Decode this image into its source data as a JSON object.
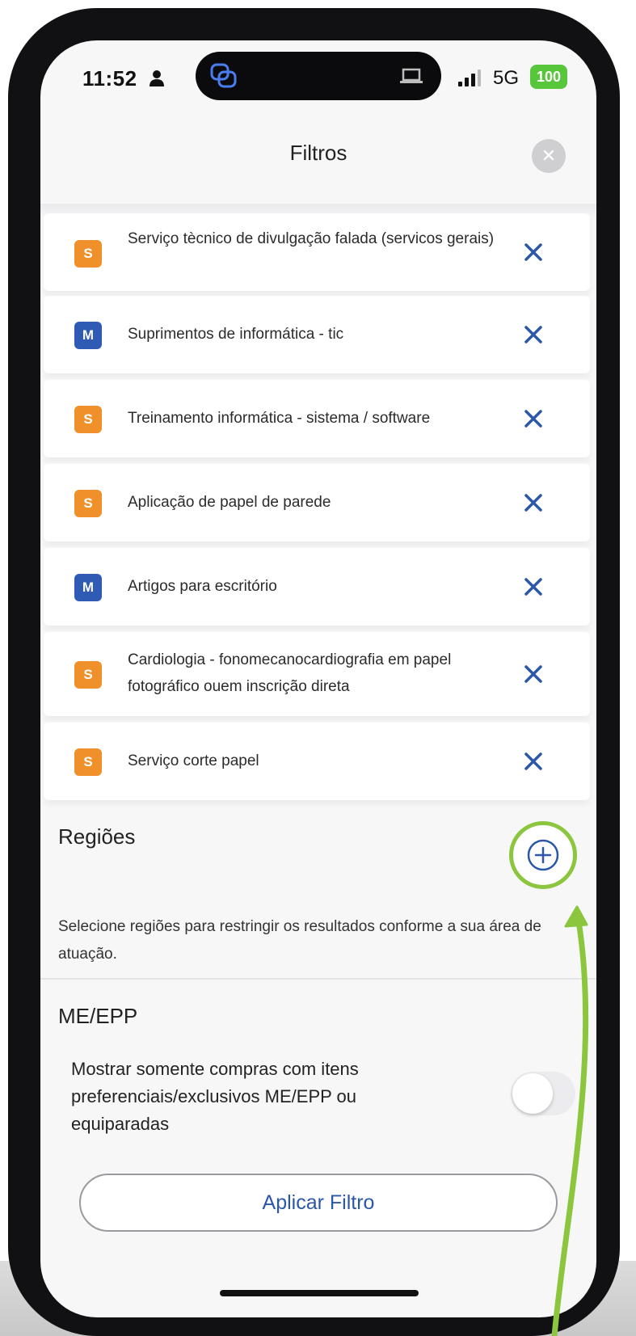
{
  "status_bar": {
    "time": "11:52",
    "network": "5G",
    "battery": "100"
  },
  "header": {
    "title": "Filtros",
    "close_icon": "close-icon"
  },
  "activities": [
    {
      "badge": "S",
      "label": "Serviço tècnico de divulgação falada (servicos gerais)"
    },
    {
      "badge": "M",
      "label": "Suprimentos de informática - tic"
    },
    {
      "badge": "S",
      "label": "Treinamento informática - sistema / software"
    },
    {
      "badge": "S",
      "label": "Aplicação de papel de parede"
    },
    {
      "badge": "M",
      "label": "Artigos para escritório"
    },
    {
      "badge": "S",
      "label": "Cardiologia - fonomecanocardiografia em papel fotográfico ouem inscrição direta"
    },
    {
      "badge": "S",
      "label": "Serviço corte papel"
    }
  ],
  "regioes": {
    "title": "Regiões",
    "description": "Selecione regiões para restringir os resultados conforme a sua área de atuação."
  },
  "me_epp": {
    "title": "ME/EPP",
    "toggle_label": "Mostrar somente compras com itens preferenciais/exclusivos ME/EPP ou equiparadas",
    "toggle_on": false
  },
  "footer": {
    "apply_label": "Aplicar Filtro"
  },
  "colors": {
    "badge_S": "#f0902a",
    "badge_M": "#2f5bb5",
    "accent_blue": "#2b57a8",
    "highlight_green": "#8cc63f",
    "battery_green": "#58c63b"
  }
}
